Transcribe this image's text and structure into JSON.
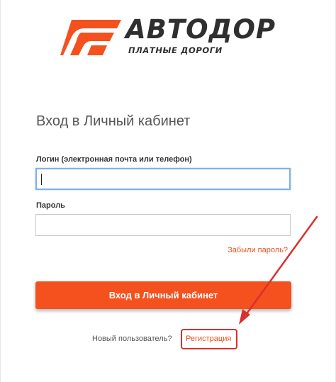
{
  "logo": {
    "brand": "АВТОДОР",
    "tagline": "ПЛАТНЫЕ ДОРОГИ",
    "accent_color": "#f4511e"
  },
  "form": {
    "title": "Вход в Личный кабинет",
    "login_label": "Логин (электронная почта или телефон)",
    "login_value": "",
    "password_label": "Пароль",
    "password_value": "",
    "forgot_link": "Забыли пароль?",
    "submit_label": "Вход в Личный кабинет"
  },
  "footer": {
    "new_user_text": "Новый пользователь?",
    "register_link": "Регистрация"
  },
  "annotation": {
    "arrow_color": "#d9302c",
    "icon": "red-arrow-icon"
  }
}
